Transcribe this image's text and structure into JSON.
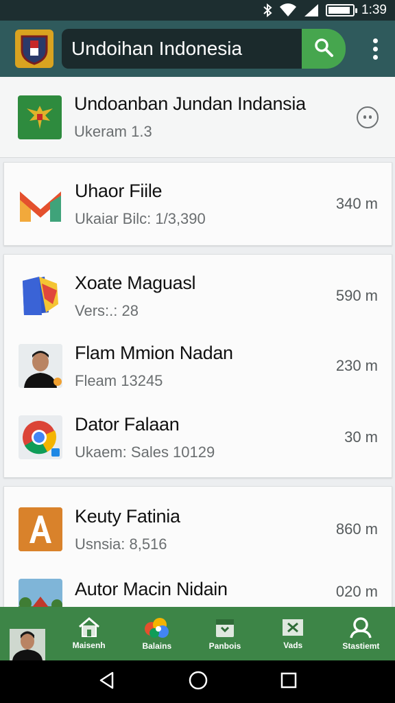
{
  "status_bar": {
    "time": "1:39",
    "icons": [
      "bluetooth-icon",
      "wifi-icon",
      "signal-icon",
      "battery-icon"
    ],
    "battery_level": 0.9
  },
  "app_bar": {
    "search_text": "Undoihan Indonesia",
    "icons": [
      "app-logo",
      "search-icon",
      "more-vert-icon"
    ]
  },
  "featured": {
    "title": "Undoanban Jundan Indansia",
    "subtitle": "Ukeram 1.3"
  },
  "cards": [
    {
      "items": [
        {
          "title": "Uhaor Fiile",
          "subtitle": "Ukaiar Bilc: 1/3,390",
          "size": "340 m",
          "icon": "gmail-icon"
        }
      ]
    },
    {
      "items": [
        {
          "title": "Xoate Maguasl",
          "subtitle": "Vers:.: 28",
          "size": "590 m",
          "icon": "docs-icon"
        },
        {
          "title": "Flam Mmion Nadan",
          "subtitle": "Fleam 13245",
          "size": "230 m",
          "icon": "person-photo"
        },
        {
          "title": "Dator Falaan",
          "subtitle": "Ukaem: Sales 10129",
          "size": "30 m",
          "icon": "chrome-icon"
        }
      ]
    },
    {
      "items": [
        {
          "title": "Keuty Fatinia",
          "subtitle": "Usnsia: 8,516",
          "size": "860 m",
          "icon": "letter-a-icon"
        },
        {
          "title": "Autor Macin Nidain",
          "subtitle": "",
          "size": "020 m",
          "icon": "house-photo"
        }
      ]
    }
  ],
  "bottom_nav": [
    {
      "label": "Maisenh",
      "icon": "home-icon"
    },
    {
      "label": "Balains",
      "icon": "photos-icon"
    },
    {
      "label": "Panbois",
      "icon": "folder-icon"
    },
    {
      "label": "Vads",
      "icon": "tools-icon"
    },
    {
      "label": "Stastiemt",
      "icon": "person-icon"
    }
  ],
  "colors": {
    "status_bar": "#1d2e30",
    "app_bar": "#2f5a5c",
    "search_button": "#46a64e",
    "bottom_nav": "#3d8547"
  }
}
